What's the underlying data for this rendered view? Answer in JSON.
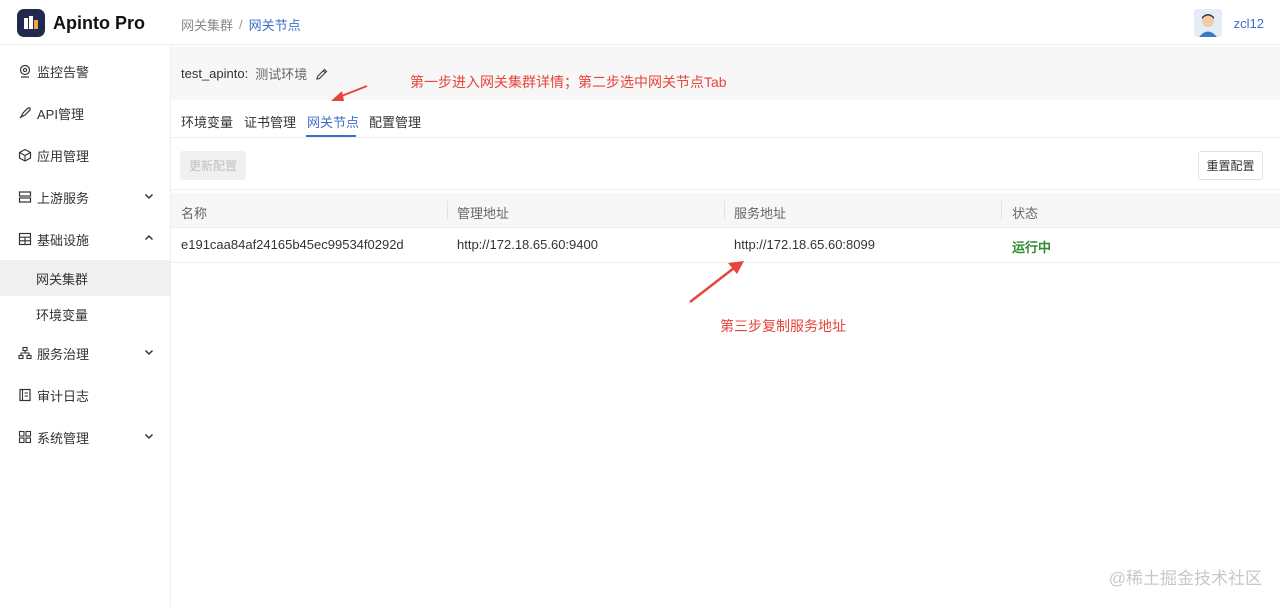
{
  "app": {
    "name": "Apinto Pro"
  },
  "breadcrumb": {
    "parent": "网关集群",
    "separator": "/",
    "current": "网关节点"
  },
  "user": {
    "name": "zcl12"
  },
  "sidebar": {
    "items": [
      {
        "label": "监控告警",
        "icon": "location-icon"
      },
      {
        "label": "API管理",
        "icon": "rocket-icon"
      },
      {
        "label": "应用管理",
        "icon": "cube-icon"
      },
      {
        "label": "上游服务",
        "icon": "server-icon",
        "expandable": true
      },
      {
        "label": "基础设施",
        "icon": "grid-icon",
        "expanded": true
      },
      {
        "label": "服务治理",
        "icon": "tree-icon",
        "expandable": true
      },
      {
        "label": "审计日志",
        "icon": "log-icon"
      },
      {
        "label": "系统管理",
        "icon": "apps-icon",
        "expandable": true
      }
    ],
    "sub": [
      {
        "label": "网关集群",
        "active": true
      },
      {
        "label": "环境变量"
      }
    ]
  },
  "page": {
    "cluster_name": "test_apinto:",
    "env_name": "测试环境"
  },
  "tabs": [
    {
      "label": "环境变量"
    },
    {
      "label": "证书管理"
    },
    {
      "label": "网关节点",
      "active": true
    },
    {
      "label": "配置管理"
    }
  ],
  "toolbar": {
    "update_label": "更新配置",
    "reset_label": "重置配置"
  },
  "table": {
    "headers": [
      "名称",
      "管理地址",
      "服务地址",
      "状态"
    ],
    "rows": [
      [
        "e191caa84af24165b45ec99534f0292d",
        "http://172.18.65.60:9400",
        "http://172.18.65.60:8099",
        "运行中"
      ]
    ]
  },
  "annotations": {
    "step1": "第一步进入网关集群详情；第二步选中网关节点Tab",
    "step3": "第三步复制服务地址"
  },
  "watermark": "@稀土掘金技术社区",
  "colors": {
    "accent": "#3d6ec7",
    "annotation": "#e8443a",
    "running": "#2e8b2e"
  }
}
